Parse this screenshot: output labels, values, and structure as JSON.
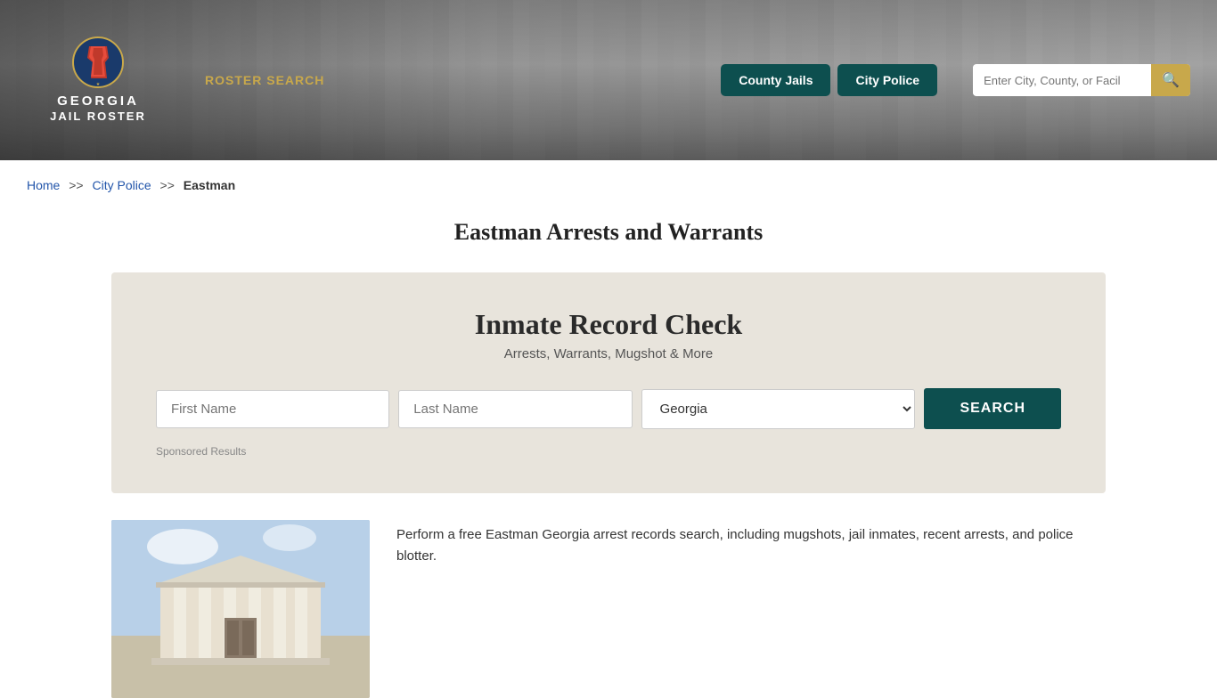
{
  "header": {
    "logo_line1": "GEORGIA",
    "logo_line2": "JAIL ROSTER",
    "nav_roster_search": "ROSTER SEARCH",
    "nav_county_jails": "County Jails",
    "nav_city_police": "City Police",
    "search_placeholder": "Enter City, County, or Facil"
  },
  "breadcrumb": {
    "home": "Home",
    "sep1": ">>",
    "city_police": "City Police",
    "sep2": ">>",
    "current": "Eastman"
  },
  "page": {
    "title": "Eastman Arrests and Warrants"
  },
  "record_check": {
    "title": "Inmate Record Check",
    "subtitle": "Arrests, Warrants, Mugshot & More",
    "first_name_placeholder": "First Name",
    "last_name_placeholder": "Last Name",
    "state_default": "Georgia",
    "search_button": "SEARCH",
    "sponsored_label": "Sponsored Results"
  },
  "bottom": {
    "description": "Perform a free Eastman Georgia arrest records search, including mugshots, jail inmates, recent arrests, and police blotter."
  }
}
